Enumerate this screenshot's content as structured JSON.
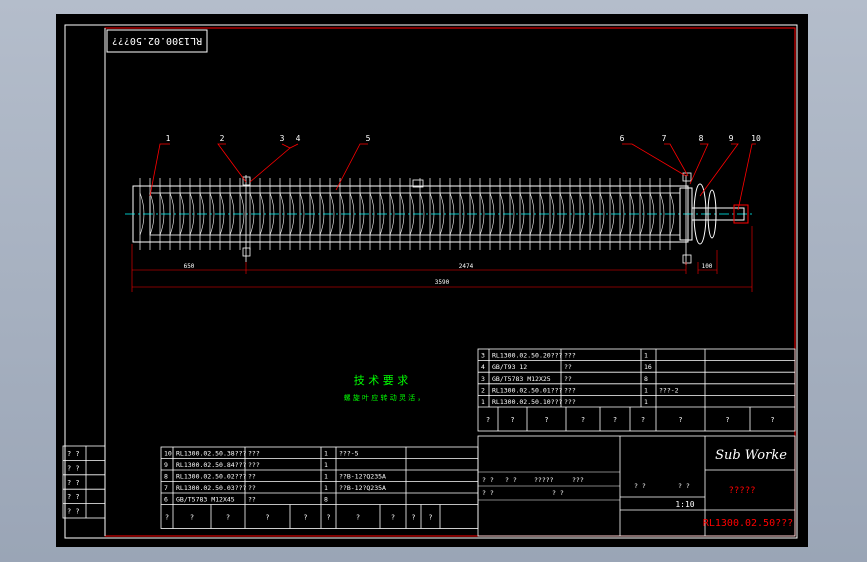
{
  "colors": {
    "background": "#000000",
    "frame": "#ff0000",
    "outline": "#ffffff",
    "text": "#ffffff",
    "centerline": "#00ffff",
    "leader": "#ff0000",
    "notes": "#00ff00",
    "dimension": "#ff0000"
  },
  "header_stamp": "RL1300.02.50???",
  "balloons": [
    "1",
    "2",
    "3",
    "4",
    "5",
    "6",
    "7",
    "8",
    "9",
    "10"
  ],
  "dimensions": {
    "left_offset": "650",
    "middle_span": "2474",
    "right_offset": "100",
    "overall_length": "3590"
  },
  "tech_requirements": {
    "title": "技 术 要 求",
    "body": "螺 旋 叶 应 转 动 灵 活 ，"
  },
  "left_margin_cells": [
    "? ?",
    "? ?",
    "? ?",
    "? ?",
    "? ?"
  ],
  "bom_upper": [
    [
      "3",
      "RL1300.02.50.20???",
      "???",
      "1",
      ""
    ],
    [
      "4",
      "GB/T93 12",
      "??",
      "16",
      ""
    ],
    [
      "3",
      "GB/T5783 M12X25",
      "??",
      "8",
      ""
    ],
    [
      "2",
      "RL1300.02.50.01???",
      "???",
      "1",
      "???-2"
    ],
    [
      "1",
      "RL1300.02.50.10???",
      "???",
      "1",
      ""
    ]
  ],
  "bom_upper_header": [
    "?",
    "?",
    "?",
    "?",
    "?",
    "?",
    "?",
    "?",
    "?"
  ],
  "bom_lower": [
    [
      "10",
      "RL1300.02.50.38???",
      "???",
      "1",
      "???-5"
    ],
    [
      "9",
      "RL1300.02.50.84???",
      "???",
      "1",
      ""
    ],
    [
      "8",
      "RL1300.02.50.02???",
      "??",
      "1",
      "??B-12?Q235A"
    ],
    [
      "7",
      "RL1300.02.50.03???",
      "??",
      "1",
      "??B-12?Q235A"
    ],
    [
      "6",
      "GB/T5783 M12X45",
      "??",
      "8",
      ""
    ]
  ],
  "bom_lower_header": [
    "?",
    "?",
    "?",
    "?",
    "?",
    "?",
    "?",
    "?",
    "?",
    "?"
  ],
  "title_block": {
    "logo": "Sub Worke",
    "drawing_name": "?????",
    "drawing_no": "RL1300.02.50???",
    "scale": "1:10",
    "marks": [
      "? ?",
      "? ?",
      "?????",
      "???",
      "? ?",
      "? ?",
      "? ?",
      "? ?"
    ]
  }
}
